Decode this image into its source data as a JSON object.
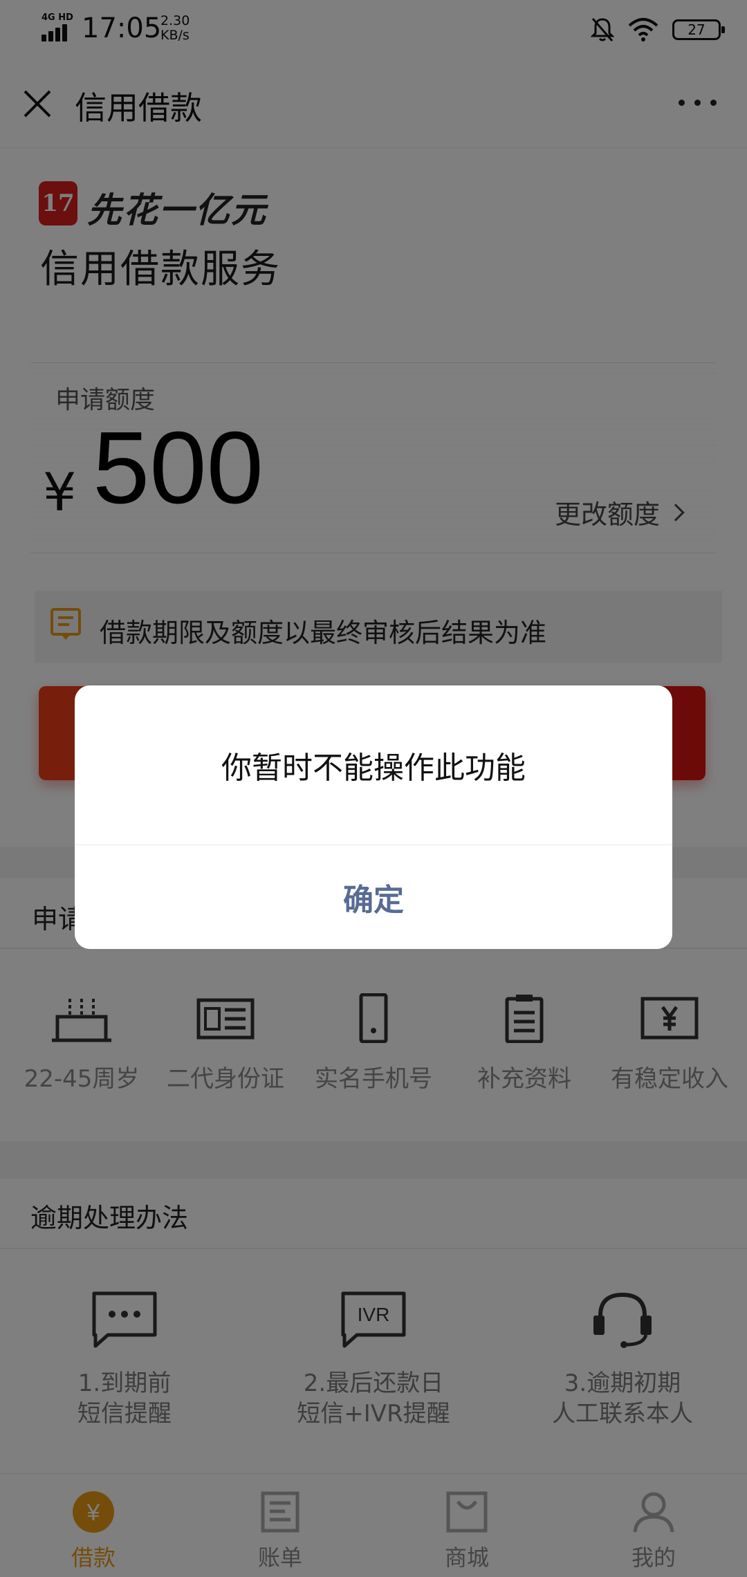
{
  "status_bar": {
    "network": "4G HD",
    "time": "17:05",
    "speed_value": "2.30",
    "speed_unit": "KB/s",
    "battery": "27"
  },
  "header": {
    "title": "信用借款"
  },
  "hero": {
    "logo_badge": "17",
    "logo_text": "先花一亿元",
    "service_title": "信用借款服务",
    "amount_label": "申请额度",
    "currency_symbol": "¥",
    "amount": "500",
    "change_link": "更改额度",
    "notice": "借款期限及额度以最终审核后结果为准"
  },
  "conditions": {
    "title": "申请",
    "items": [
      {
        "label": "22-45周岁",
        "icon": "cake-icon"
      },
      {
        "label": "二代身份证",
        "icon": "id-card-icon"
      },
      {
        "label": "实名手机号",
        "icon": "phone-icon"
      },
      {
        "label": "补充资料",
        "icon": "clipboard-icon"
      },
      {
        "label": "有稳定收入",
        "icon": "yen-note-icon"
      }
    ]
  },
  "overdue": {
    "title": "逾期处理办法",
    "items": [
      {
        "line1": "1.到期前",
        "line2": "短信提醒",
        "icon": "sms-icon"
      },
      {
        "line1": "2.最后还款日",
        "line2": "短信+IVR提醒",
        "icon": "ivr-icon",
        "icon_text": "IVR"
      },
      {
        "line1": "3.逾期初期",
        "line2": "人工联系本人",
        "icon": "headset-icon"
      }
    ]
  },
  "tabbar": {
    "items": [
      {
        "label": "借款",
        "active": true,
        "icon": "yen-coin-icon",
        "icon_text": "¥"
      },
      {
        "label": "账单",
        "active": false,
        "icon": "bill-icon"
      },
      {
        "label": "商城",
        "active": false,
        "icon": "shop-bag-icon"
      },
      {
        "label": "我的",
        "active": false,
        "icon": "user-icon"
      }
    ]
  },
  "dialog": {
    "message": "你暂时不能操作此功能",
    "confirm": "确定"
  },
  "colors": {
    "accent_orange": "#e89a14",
    "brand_red": "#d81e1e",
    "dialog_link": "#576b95"
  }
}
